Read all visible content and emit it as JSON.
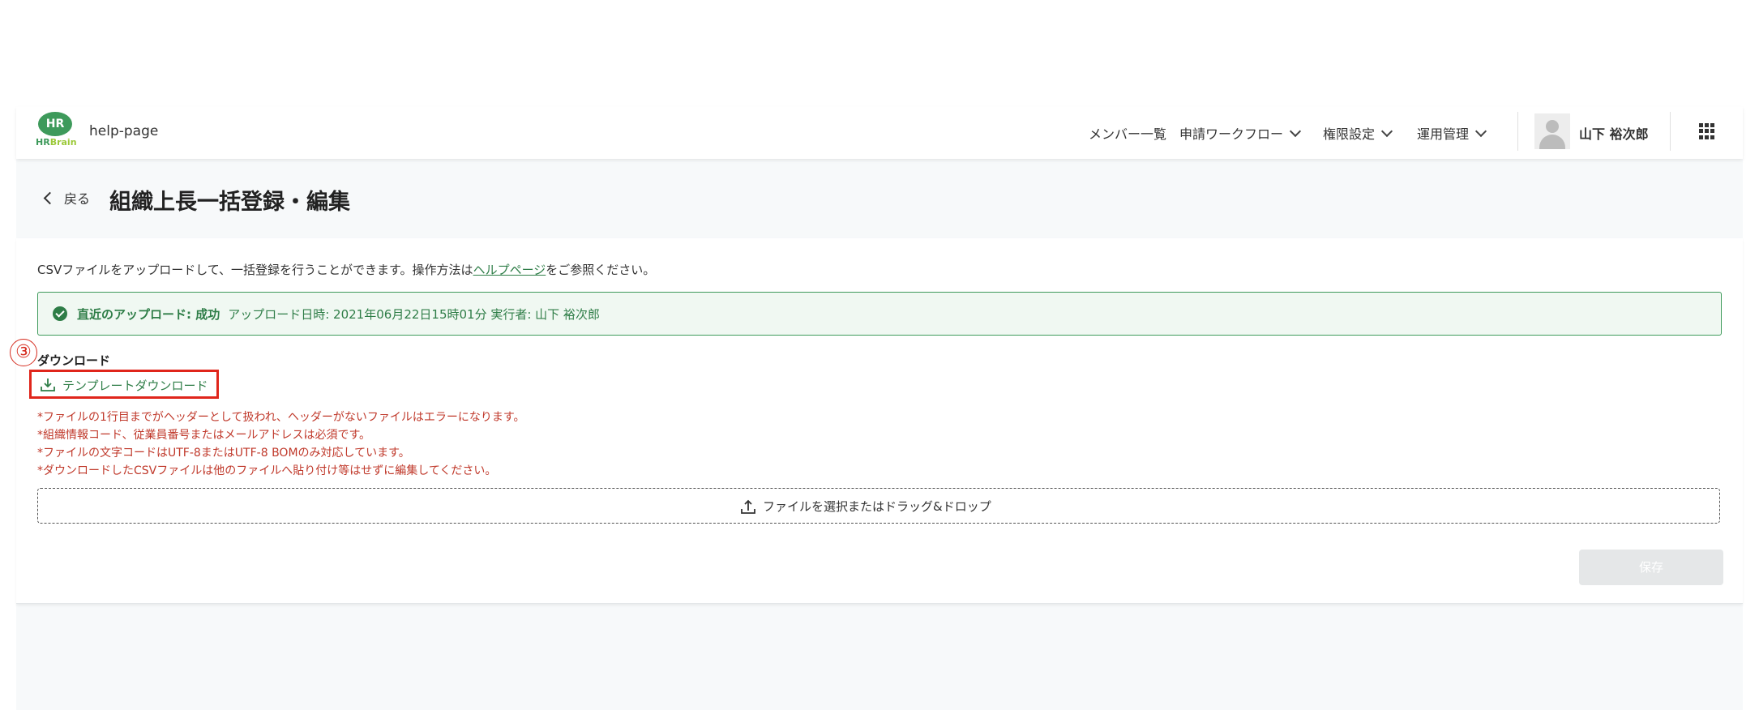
{
  "header": {
    "logo_text": "HR",
    "logo_brand_a": "HR",
    "logo_brand_b": "Brain",
    "app_name": "help-page",
    "nav": [
      {
        "label": "メンバー一覧"
      },
      {
        "label": "申請ワークフロー"
      },
      {
        "label": "権限設定"
      },
      {
        "label": "運用管理"
      }
    ],
    "user_name": "山下 裕次郎"
  },
  "page": {
    "back_label": "戻る",
    "title": "組織上長一括登録・編集"
  },
  "description": {
    "before": "CSVファイルをアップロードして、一括登録を行うことができます。操作方法は",
    "link": "ヘルプページ",
    "after": "をご参照ください。"
  },
  "status": {
    "label": "直近のアップロード: 成功",
    "detail": "アップロード日時: 2021年06月22日15時01分  実行者: 山下 裕次郎"
  },
  "annotation": {
    "step": "③"
  },
  "download": {
    "heading": "ダウンロード",
    "button_label": "テンプレートダウンロード"
  },
  "notes": [
    "*ファイルの1行目までがヘッダーとして扱われ、ヘッダーがないファイルはエラーになります。",
    "*組織情報コード、従業員番号またはメールアドレスは必須です。",
    "*ファイルの文字コードはUTF-8またはUTF-8 BOMのみ対応しています。",
    "*ダウンロードしたCSVファイルは他のファイルへ貼り付け等はせずに編集してください。"
  ],
  "upload": {
    "label": "ファイルを選択またはドラッグ&ドロップ"
  },
  "actions": {
    "save_label": "保存"
  },
  "colors": {
    "brand_green": "#3e9a5b",
    "success_text": "#2e7d47",
    "note_red": "#c0392b",
    "annotation_red": "#e0251b"
  }
}
